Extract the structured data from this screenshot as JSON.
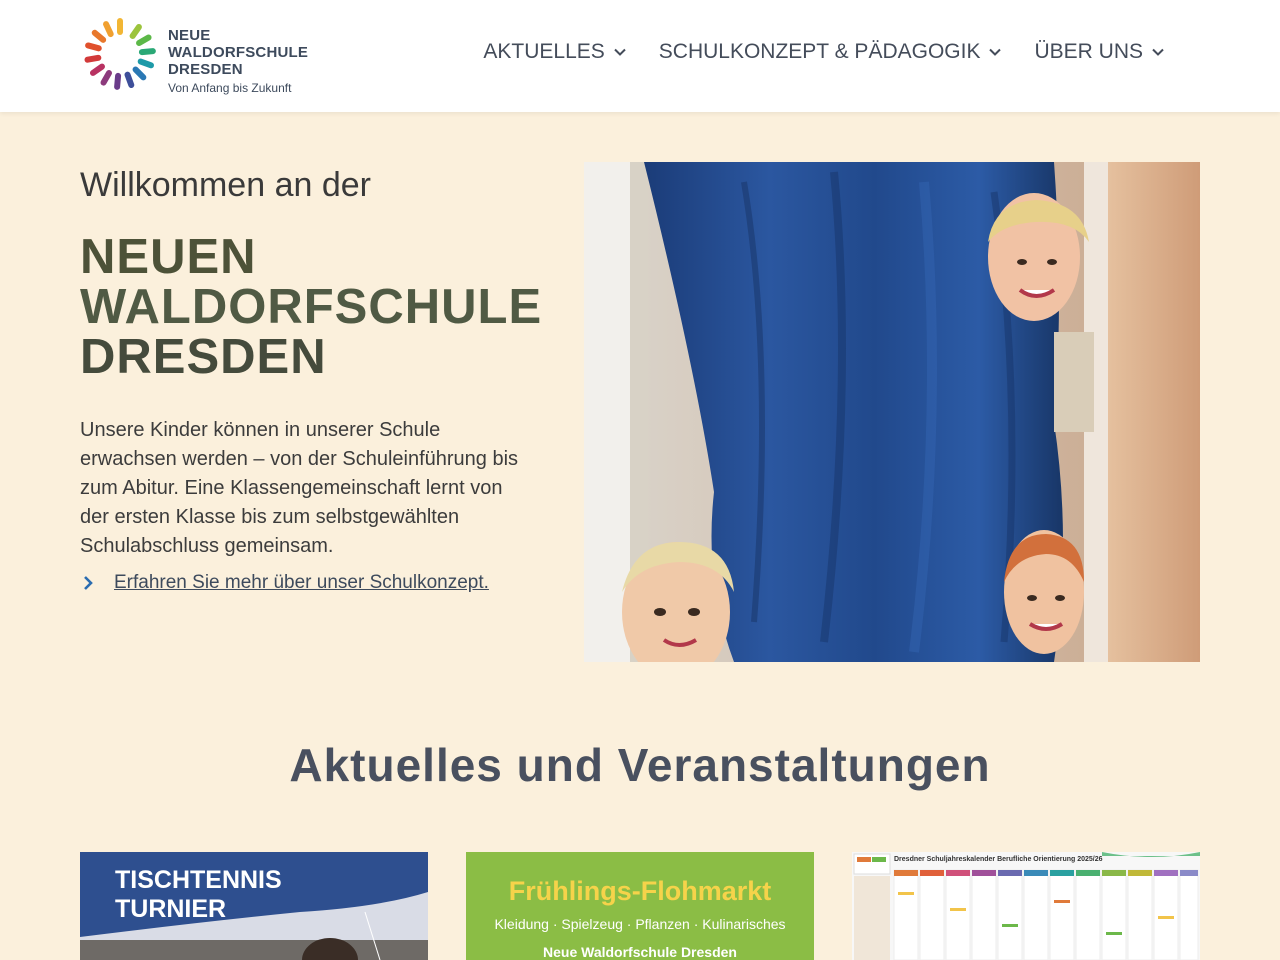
{
  "header": {
    "logo": {
      "line1": "NEUE",
      "line2": "WALDORFSCHULE",
      "line3": "DRESDEN",
      "tagline": "Von Anfang bis Zukunft"
    },
    "nav": [
      {
        "label": "AKTUELLES",
        "icon": "chevron-down-icon"
      },
      {
        "label": "SCHULKONZEPT & PÄDAGOGIK",
        "icon": "chevron-down-icon"
      },
      {
        "label": "ÜBER UNS",
        "icon": "chevron-down-icon"
      }
    ]
  },
  "hero": {
    "welcome": "Willkommen an der",
    "title_line1": "NEUEN",
    "title_line2": "WALDORFSCHULE",
    "title_line3": "DRESDEN",
    "text": "Unsere Kinder können in unserer Schule erwachsen werden – von der Schuleinführung bis zum Abitur. Eine Klassengemeinschaft lernt von der ersten Klasse bis zum selbstgewählten Schulabschluss gemeinsam.",
    "link_label": "Erfahren Sie mehr über unser Schulkonzept.",
    "link_icon": "chevron-right-icon"
  },
  "news": {
    "title": "Aktuelles und Veranstaltungen",
    "cards": [
      {
        "title_line1": "TISCHTENNIS",
        "title_line2": "TURNIER"
      },
      {
        "title": "Frühlings-Flohmarkt",
        "subtitle": "Kleidung · Spielzeug · Pflanzen · Kulinarisches",
        "org": "Neue Waldorfschule Dresden"
      },
      {
        "title": "Dresdner Schuljahreskalender Berufliche Orientierung 2025/26"
      }
    ]
  },
  "colors": {
    "background": "#fbf0dc",
    "header_bg": "#ffffff",
    "nav_text": "#444c5a",
    "card1_bg": "#2e4f8f",
    "card2_bg": "#8bbd45",
    "card2_title": "#f6d34a"
  }
}
